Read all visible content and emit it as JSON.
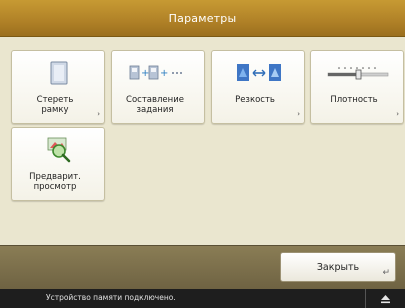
{
  "title": "Параметры",
  "tiles": [
    {
      "label": "Стереть\nрамку",
      "icon": "erase-frame-icon",
      "has_arrow": true
    },
    {
      "label": "Составление\nзадания",
      "icon": "job-build-icon",
      "has_arrow": false
    },
    {
      "label": "Резкость",
      "icon": "sharpness-icon",
      "has_arrow": true
    },
    {
      "label": "Плотность",
      "icon": "density-icon",
      "has_arrow": true
    },
    {
      "label": "Предварит.\nпросмотр",
      "icon": "preview-icon",
      "has_arrow": false
    }
  ],
  "tile_arrow": "›",
  "close_label": "Закрыть",
  "close_return_glyph": "↵",
  "status_message": "Устройство памяти подключено.",
  "colors": {
    "title_bar": "#b08127",
    "background": "#eae6cf",
    "action_bar": "#7a6d4a",
    "status_bar": "#1e1e1e"
  }
}
